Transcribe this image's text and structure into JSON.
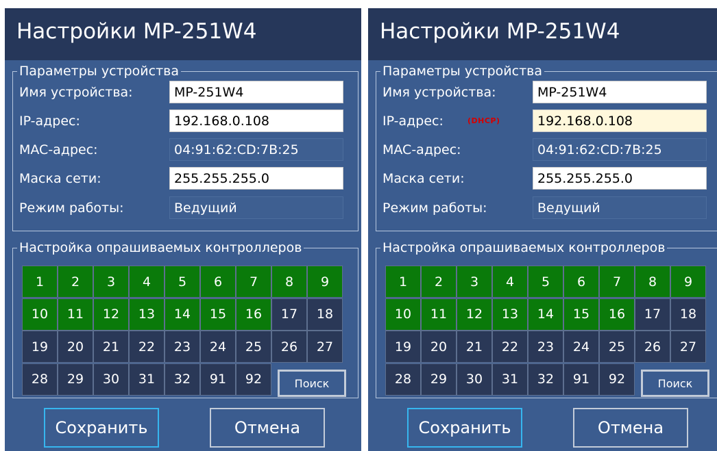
{
  "panels": [
    {
      "title": "Настройки MP-251W4",
      "device_params": {
        "legend": "Параметры устройства",
        "name_label": "Имя устройства:",
        "name_value": "MP-251W4",
        "ip_label": "IP-адрес:",
        "ip_value": "192.168.0.108",
        "dhcp_tag": "",
        "mac_label": "MAC-адрес:",
        "mac_value": "04:91:62:CD:7B:25",
        "mask_label": "Маска сети:",
        "mask_value": "255.255.255.0",
        "mode_label": "Режим работы:",
        "mode_value": "Ведущий"
      },
      "controllers": {
        "legend": "Настройка опрашиваемых контроллеров",
        "cells": [
          {
            "label": "1",
            "on": true
          },
          {
            "label": "2",
            "on": true
          },
          {
            "label": "3",
            "on": true
          },
          {
            "label": "4",
            "on": true
          },
          {
            "label": "5",
            "on": true
          },
          {
            "label": "6",
            "on": true
          },
          {
            "label": "7",
            "on": true
          },
          {
            "label": "8",
            "on": true
          },
          {
            "label": "9",
            "on": true
          },
          {
            "label": "10",
            "on": true
          },
          {
            "label": "11",
            "on": true
          },
          {
            "label": "12",
            "on": true
          },
          {
            "label": "13",
            "on": true
          },
          {
            "label": "14",
            "on": true
          },
          {
            "label": "15",
            "on": true
          },
          {
            "label": "16",
            "on": true
          },
          {
            "label": "17",
            "on": false
          },
          {
            "label": "18",
            "on": false
          },
          {
            "label": "19",
            "on": false
          },
          {
            "label": "20",
            "on": false
          },
          {
            "label": "21",
            "on": false
          },
          {
            "label": "22",
            "on": false
          },
          {
            "label": "23",
            "on": false
          },
          {
            "label": "24",
            "on": false
          },
          {
            "label": "25",
            "on": false
          },
          {
            "label": "26",
            "on": false
          },
          {
            "label": "27",
            "on": false
          },
          {
            "label": "28",
            "on": false
          },
          {
            "label": "29",
            "on": false
          },
          {
            "label": "30",
            "on": false
          },
          {
            "label": "31",
            "on": false
          },
          {
            "label": "32",
            "on": false
          },
          {
            "label": "91",
            "on": false
          },
          {
            "label": "92",
            "on": false
          }
        ],
        "search_label": "Поиск"
      },
      "save_label": "Сохранить",
      "cancel_label": "Отмена"
    },
    {
      "title": "Настройки MP-251W4",
      "device_params": {
        "legend": "Параметры устройства",
        "name_label": "Имя устройства:",
        "name_value": "MP-251W4",
        "ip_label": "IP-адрес:",
        "ip_value": "192.168.0.108",
        "dhcp_tag": "(DHCP)",
        "mac_label": "MAC-адрес:",
        "mac_value": "04:91:62:CD:7B:25",
        "mask_label": "Маска сети:",
        "mask_value": "255.255.255.0",
        "mode_label": "Режим работы:",
        "mode_value": "Ведущий"
      },
      "controllers": {
        "legend": "Настройка опрашиваемых контроллеров",
        "cells": [
          {
            "label": "1",
            "on": true
          },
          {
            "label": "2",
            "on": true
          },
          {
            "label": "3",
            "on": true
          },
          {
            "label": "4",
            "on": true
          },
          {
            "label": "5",
            "on": true
          },
          {
            "label": "6",
            "on": true
          },
          {
            "label": "7",
            "on": true
          },
          {
            "label": "8",
            "on": true
          },
          {
            "label": "9",
            "on": true
          },
          {
            "label": "10",
            "on": true
          },
          {
            "label": "11",
            "on": true
          },
          {
            "label": "12",
            "on": true
          },
          {
            "label": "13",
            "on": true
          },
          {
            "label": "14",
            "on": true
          },
          {
            "label": "15",
            "on": true
          },
          {
            "label": "16",
            "on": true
          },
          {
            "label": "17",
            "on": false
          },
          {
            "label": "18",
            "on": false
          },
          {
            "label": "19",
            "on": false
          },
          {
            "label": "20",
            "on": false
          },
          {
            "label": "21",
            "on": false
          },
          {
            "label": "22",
            "on": false
          },
          {
            "label": "23",
            "on": false
          },
          {
            "label": "24",
            "on": false
          },
          {
            "label": "25",
            "on": false
          },
          {
            "label": "26",
            "on": false
          },
          {
            "label": "27",
            "on": false
          },
          {
            "label": "28",
            "on": false
          },
          {
            "label": "29",
            "on": false
          },
          {
            "label": "30",
            "on": false
          },
          {
            "label": "31",
            "on": false
          },
          {
            "label": "32",
            "on": false
          },
          {
            "label": "91",
            "on": false
          },
          {
            "label": "92",
            "on": false
          }
        ],
        "search_label": "Поиск"
      },
      "save_label": "Сохранить",
      "cancel_label": "Отмена"
    }
  ],
  "colors": {
    "title_bar": "#26375a",
    "panel_bg": "#3b5c8f",
    "cell_on": "#0a7a0a",
    "cell_off": "#2a3857",
    "dhcp_tag": "#d40000",
    "dhcp_field": "#fff8dc",
    "save_border": "#36b6ef"
  }
}
